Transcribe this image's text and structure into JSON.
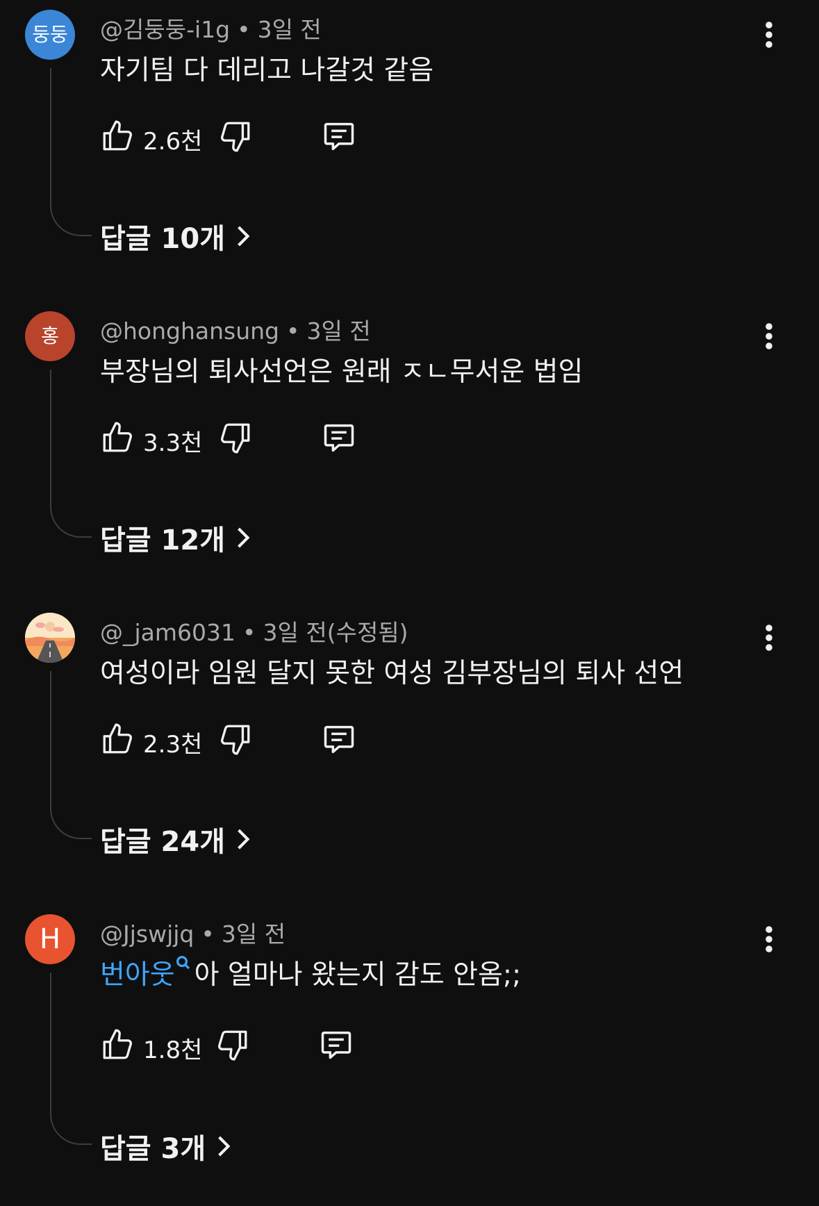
{
  "comments": [
    {
      "avatar_text": "둥둥",
      "avatar_color": "#3b86d6",
      "author": "@김둥둥-i1g",
      "time": "3일 전",
      "text": "자기팀 다 데리고 나갈것 같음",
      "likes": "2.6천",
      "replies": "답글 10개"
    },
    {
      "avatar_text": "홍",
      "avatar_color": "#b8442c",
      "author": "@honghansung",
      "time": "3일 전",
      "text": "부장님의 퇴사선언은 원래 ㅈㄴ무서운 법임",
      "likes": "3.3천",
      "replies": "답글 12개"
    },
    {
      "avatar_text": "",
      "avatar_color": "#f5c28a",
      "author": "@_jam6031",
      "time": "3일 전(수정됨)",
      "text": "여성이라 임원 달지 못한 여성 김부장님의 퇴사 선언",
      "likes": "2.3천",
      "replies": "답글 24개"
    },
    {
      "avatar_text": "H",
      "avatar_color": "#e8542f",
      "author": "@Jjswjjq",
      "time": "3일 전",
      "text_link": "번아웃",
      "text": "아 얼마나 왔는지 감도 안옴;;",
      "likes": "1.8천",
      "replies": "답글 3개"
    }
  ],
  "icons": {
    "like": "thumb-up-icon",
    "dislike": "thumb-down-icon",
    "reply": "comment-icon",
    "more": "more-vert-icon",
    "chevron": "chevron-right-icon",
    "search": "search-icon"
  }
}
